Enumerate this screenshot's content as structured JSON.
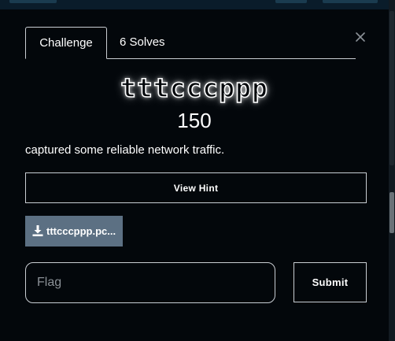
{
  "tabs": [
    {
      "label": "Challenge",
      "active": true
    },
    {
      "label": "6 Solves",
      "active": false
    }
  ],
  "challenge": {
    "name": "tttcccppp",
    "points": "150",
    "description": "captured some reliable network traffic."
  },
  "hint": {
    "label": "View Hint"
  },
  "file": {
    "label": "tttcccppp.pc...",
    "icon": "download-icon"
  },
  "flag": {
    "placeholder": "Flag",
    "value": ""
  },
  "submit": {
    "label": "Submit"
  },
  "colors": {
    "modal_bg": "#03070b",
    "file_button_bg": "#5c7083",
    "border": "#c9ced3",
    "text": "#ffffff"
  }
}
